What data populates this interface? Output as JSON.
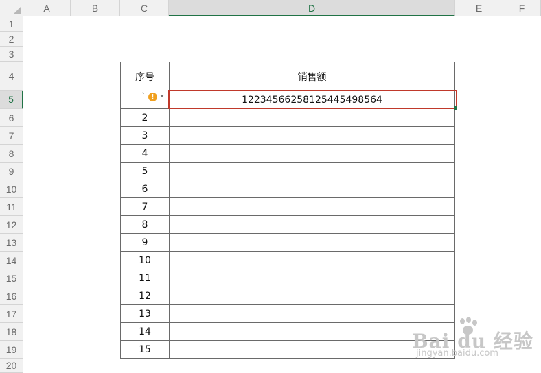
{
  "columns": [
    "A",
    "B",
    "C",
    "D",
    "E",
    "F"
  ],
  "rows": [
    "1",
    "2",
    "3",
    "4",
    "5",
    "6",
    "7",
    "8",
    "9",
    "10",
    "11",
    "12",
    "13",
    "14",
    "15",
    "16",
    "17",
    "18",
    "19",
    "20"
  ],
  "table": {
    "headers": [
      "序号",
      "销售额"
    ],
    "first_row_value": "1223456625812544549856​4",
    "first_row_index_partial": "`",
    "warning_icon_glyph": "!",
    "index_values": [
      "2",
      "3",
      "4",
      "5",
      "6",
      "7",
      "8",
      "9",
      "10",
      "11",
      "12",
      "13",
      "14",
      "15"
    ]
  },
  "watermark": {
    "main": "Bai du 经验",
    "sub": "jingyan.baidu.com"
  },
  "colors": {
    "selection_green": "#217346",
    "active_cell_red": "#c0392b",
    "warning_orange": "#f0a020"
  }
}
